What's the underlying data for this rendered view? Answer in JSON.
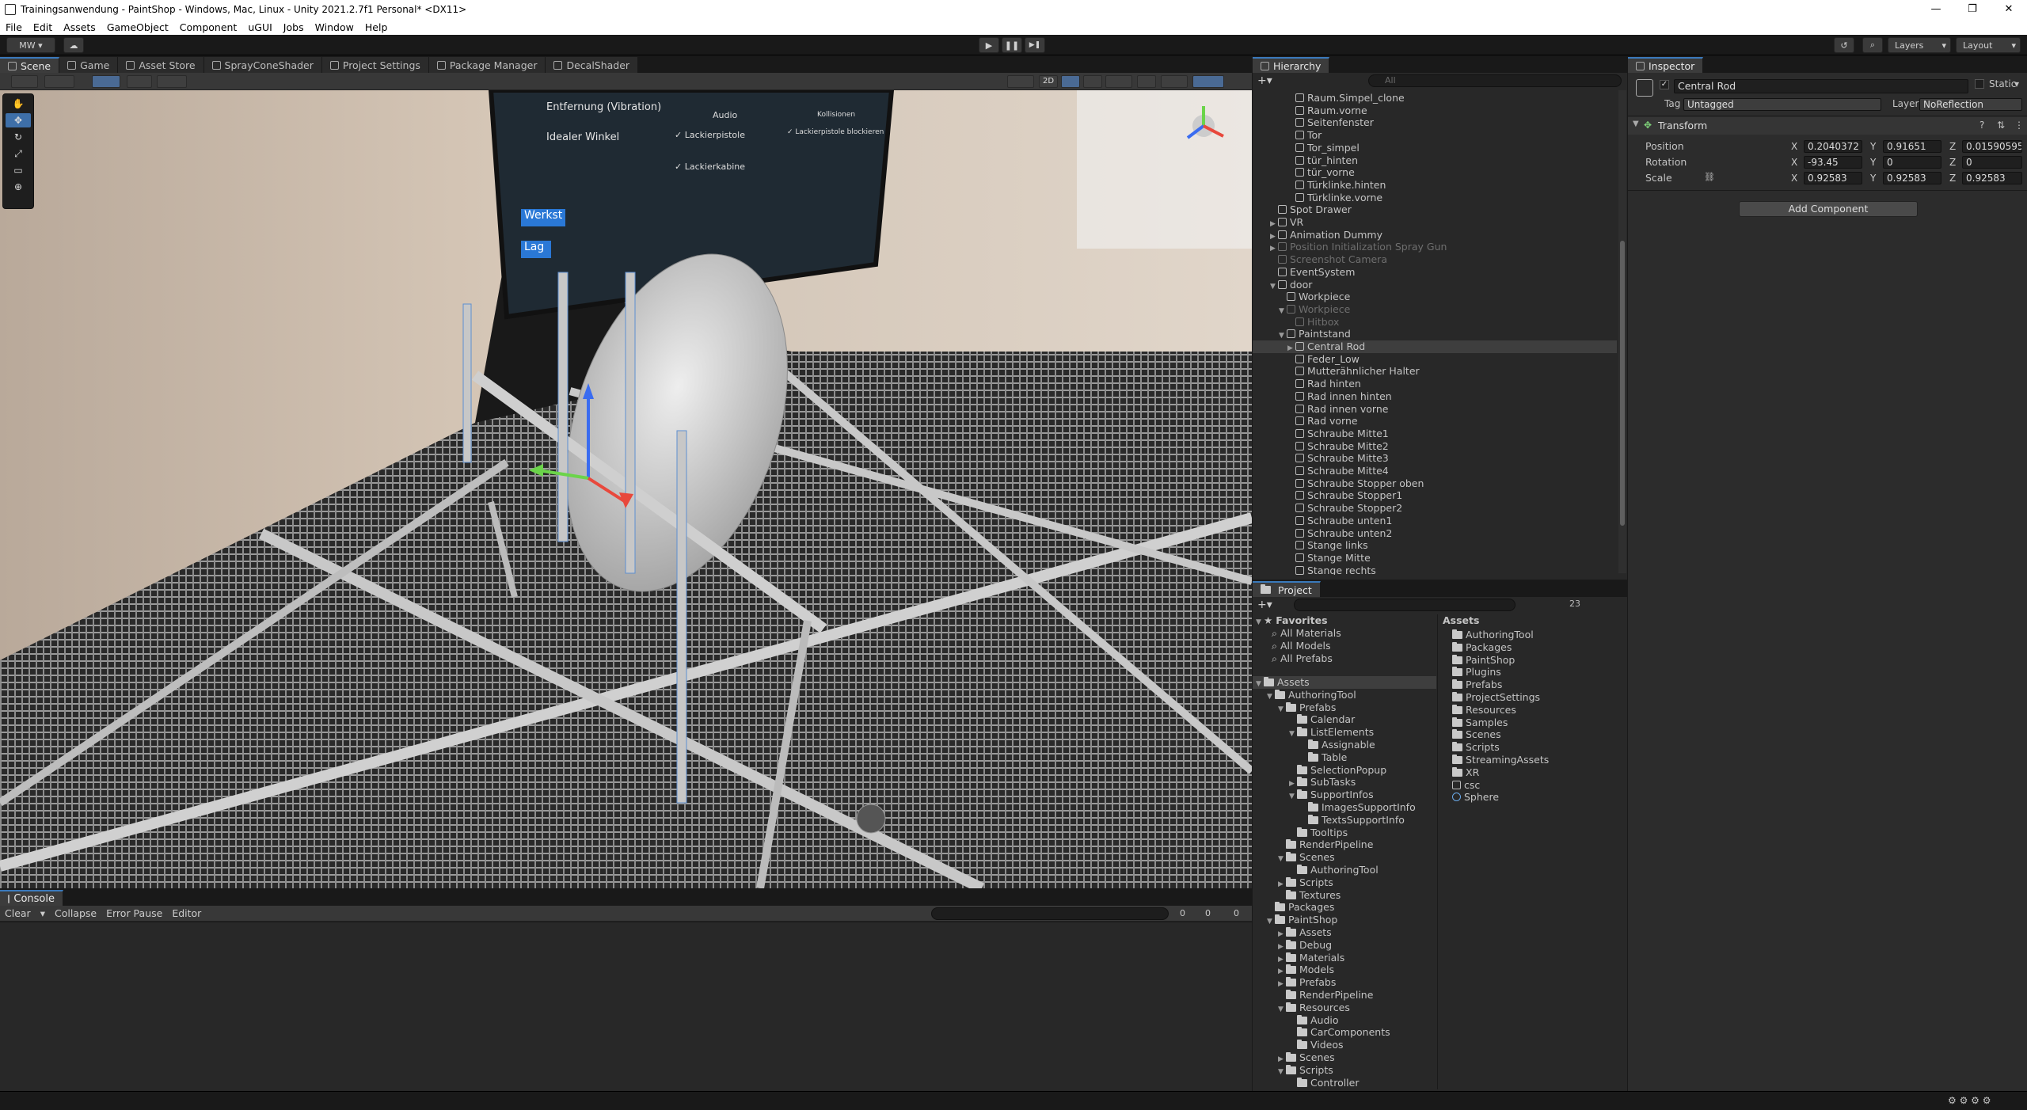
{
  "window": {
    "title": "Trainingsanwendung - PaintShop - Windows, Mac, Linux - Unity 2021.2.7f1 Personal* <DX11>",
    "controls": [
      "—",
      "❐",
      "✕"
    ]
  },
  "menu": [
    "File",
    "Edit",
    "Assets",
    "GameObject",
    "Component",
    "uGUI",
    "Jobs",
    "Window",
    "Help"
  ],
  "toolbar": {
    "account": "MW ▾",
    "play": "▶",
    "pause": "❚❚",
    "step": "▶❚",
    "layers": "Layers",
    "layout": "Layout"
  },
  "scene_tabs": [
    {
      "label": "Scene",
      "active": true
    },
    {
      "label": "Game",
      "active": false
    },
    {
      "label": "Asset Store",
      "active": false
    },
    {
      "label": "SprayConeShader",
      "active": false
    },
    {
      "label": "Project Settings",
      "active": false
    },
    {
      "label": "Package Manager",
      "active": false
    },
    {
      "label": "DecalShader",
      "active": false
    }
  ],
  "scene_toolbar": {
    "mode_2d": "2D"
  },
  "scene_view": {
    "board": {
      "item1": "Entfernung (Vibration)",
      "item2": "Idealer Winkel",
      "audio_heading": "Audio",
      "audio_check1": "Lackierpistole",
      "audio_check2": "Lackierkabine",
      "collision_heading": "Kollisionen",
      "collision_check": "Lackierpistole blockieren",
      "btn1": "Werkst",
      "btn2": "Lag"
    }
  },
  "console": {
    "tab": "Console",
    "clear": "Clear",
    "collapse": "Collapse",
    "error_pause": "Error Pause",
    "editor": "Editor",
    "count_info": "0",
    "count_warn": "0",
    "count_error": "0"
  },
  "hierarchy": {
    "tab": "Hierarchy",
    "search_placeholder": "All",
    "rows": [
      {
        "label": "Raum.Simpel_clone",
        "indent": 4,
        "dim": false,
        "arrow": ""
      },
      {
        "label": "Raum.vorne",
        "indent": 4,
        "dim": false,
        "arrow": ""
      },
      {
        "label": "Seitenfenster",
        "indent": 4,
        "dim": false,
        "arrow": ""
      },
      {
        "label": "Tor",
        "indent": 4,
        "dim": false,
        "arrow": ""
      },
      {
        "label": "Tor_simpel",
        "indent": 4,
        "dim": false,
        "arrow": ""
      },
      {
        "label": "tür_hinten",
        "indent": 4,
        "dim": false,
        "arrow": ""
      },
      {
        "label": "tür_vorne",
        "indent": 4,
        "dim": false,
        "arrow": ""
      },
      {
        "label": "Türklinke.hinten",
        "indent": 4,
        "dim": false,
        "arrow": ""
      },
      {
        "label": "Türklinke.vorne",
        "indent": 4,
        "dim": false,
        "arrow": ""
      },
      {
        "label": "Spot Drawer",
        "indent": 2,
        "dim": false,
        "arrow": ""
      },
      {
        "label": "VR",
        "indent": 2,
        "dim": false,
        "arrow": "▶"
      },
      {
        "label": "Animation Dummy",
        "indent": 2,
        "dim": false,
        "arrow": "▶"
      },
      {
        "label": "Position Initialization Spray Gun",
        "indent": 2,
        "dim": true,
        "arrow": "▶"
      },
      {
        "label": "Screenshot Camera",
        "indent": 2,
        "dim": true,
        "arrow": ""
      },
      {
        "label": "EventSystem",
        "indent": 2,
        "dim": false,
        "arrow": ""
      },
      {
        "label": "door",
        "indent": 2,
        "dim": false,
        "arrow": "▼"
      },
      {
        "label": "Workpiece",
        "indent": 3,
        "dim": false,
        "arrow": ""
      },
      {
        "label": "Workpiece",
        "indent": 3,
        "dim": true,
        "arrow": "▼"
      },
      {
        "label": "Hitbox",
        "indent": 4,
        "dim": true,
        "arrow": ""
      },
      {
        "label": "Paintstand",
        "indent": 3,
        "dim": false,
        "arrow": "▼"
      },
      {
        "label": "Central Rod",
        "indent": 4,
        "dim": false,
        "arrow": "▶",
        "selected": true
      },
      {
        "label": "Feder_Low",
        "indent": 4,
        "dim": false,
        "arrow": ""
      },
      {
        "label": "Mutterähnlicher Halter",
        "indent": 4,
        "dim": false,
        "arrow": ""
      },
      {
        "label": "Rad hinten",
        "indent": 4,
        "dim": false,
        "arrow": ""
      },
      {
        "label": "Rad innen hinten",
        "indent": 4,
        "dim": false,
        "arrow": ""
      },
      {
        "label": "Rad innen vorne",
        "indent": 4,
        "dim": false,
        "arrow": ""
      },
      {
        "label": "Rad vorne",
        "indent": 4,
        "dim": false,
        "arrow": ""
      },
      {
        "label": "Schraube Mitte1",
        "indent": 4,
        "dim": false,
        "arrow": ""
      },
      {
        "label": "Schraube Mitte2",
        "indent": 4,
        "dim": false,
        "arrow": ""
      },
      {
        "label": "Schraube Mitte3",
        "indent": 4,
        "dim": false,
        "arrow": ""
      },
      {
        "label": "Schraube Mitte4",
        "indent": 4,
        "dim": false,
        "arrow": ""
      },
      {
        "label": "Schraube Stopper oben",
        "indent": 4,
        "dim": false,
        "arrow": ""
      },
      {
        "label": "Schraube Stopper1",
        "indent": 4,
        "dim": false,
        "arrow": ""
      },
      {
        "label": "Schraube Stopper2",
        "indent": 4,
        "dim": false,
        "arrow": ""
      },
      {
        "label": "Schraube unten1",
        "indent": 4,
        "dim": false,
        "arrow": ""
      },
      {
        "label": "Schraube unten2",
        "indent": 4,
        "dim": false,
        "arrow": ""
      },
      {
        "label": "Stange links",
        "indent": 4,
        "dim": false,
        "arrow": ""
      },
      {
        "label": "Stange Mitte",
        "indent": 4,
        "dim": false,
        "arrow": ""
      },
      {
        "label": "Stange rechts",
        "indent": 4,
        "dim": false,
        "arrow": ""
      }
    ]
  },
  "inspector": {
    "tab": "Inspector",
    "object_name": "Central Rod",
    "static_label": "Static",
    "tag_label": "Tag",
    "tag_value": "Untagged",
    "layer_label": "Layer",
    "layer_value": "NoReflection",
    "component": "Transform",
    "position_label": "Position",
    "rotation_label": "Rotation",
    "scale_label": "Scale",
    "position": {
      "x": "0.2040372",
      "y": "0.91651",
      "z": "0.01590595"
    },
    "rotation": {
      "x": "-93.45",
      "y": "0",
      "z": "0"
    },
    "scale": {
      "x": "0.92583",
      "y": "0.92583",
      "z": "0.92583"
    },
    "add_component": "Add Component"
  },
  "project": {
    "tab": "Project",
    "hidden_count": "23",
    "favorites_label": "Favorites",
    "favorites": [
      "All Materials",
      "All Models",
      "All Prefabs"
    ],
    "tree": [
      {
        "label": "Assets",
        "indent": 0,
        "arrow": "▼",
        "selected": true
      },
      {
        "label": "AuthoringTool",
        "indent": 1,
        "arrow": "▼"
      },
      {
        "label": "Prefabs",
        "indent": 2,
        "arrow": "▼"
      },
      {
        "label": "Calendar",
        "indent": 3,
        "arrow": ""
      },
      {
        "label": "ListElements",
        "indent": 3,
        "arrow": "▼"
      },
      {
        "label": "Assignable",
        "indent": 4,
        "arrow": ""
      },
      {
        "label": "Table",
        "indent": 4,
        "arrow": ""
      },
      {
        "label": "SelectionPopup",
        "indent": 3,
        "arrow": ""
      },
      {
        "label": "SubTasks",
        "indent": 3,
        "arrow": "▶"
      },
      {
        "label": "SupportInfos",
        "indent": 3,
        "arrow": "▼"
      },
      {
        "label": "ImagesSupportInfo",
        "indent": 4,
        "arrow": ""
      },
      {
        "label": "TextsSupportInfo",
        "indent": 4,
        "arrow": ""
      },
      {
        "label": "Tooltips",
        "indent": 3,
        "arrow": ""
      },
      {
        "label": "RenderPipeline",
        "indent": 2,
        "arrow": ""
      },
      {
        "label": "Scenes",
        "indent": 2,
        "arrow": "▼"
      },
      {
        "label": "AuthoringTool",
        "indent": 3,
        "arrow": ""
      },
      {
        "label": "Scripts",
        "indent": 2,
        "arrow": "▶"
      },
      {
        "label": "Textures",
        "indent": 2,
        "arrow": ""
      },
      {
        "label": "Packages",
        "indent": 1,
        "arrow": ""
      },
      {
        "label": "PaintShop",
        "indent": 1,
        "arrow": "▼"
      },
      {
        "label": "Assets",
        "indent": 2,
        "arrow": "▶"
      },
      {
        "label": "Debug",
        "indent": 2,
        "arrow": "▶"
      },
      {
        "label": "Materials",
        "indent": 2,
        "arrow": "▶"
      },
      {
        "label": "Models",
        "indent": 2,
        "arrow": "▶"
      },
      {
        "label": "Prefabs",
        "indent": 2,
        "arrow": "▶"
      },
      {
        "label": "RenderPipeline",
        "indent": 2,
        "arrow": ""
      },
      {
        "label": "Resources",
        "indent": 2,
        "arrow": "▼"
      },
      {
        "label": "Audio",
        "indent": 3,
        "arrow": ""
      },
      {
        "label": "CarComponents",
        "indent": 3,
        "arrow": ""
      },
      {
        "label": "Videos",
        "indent": 3,
        "arrow": ""
      },
      {
        "label": "Scenes",
        "indent": 2,
        "arrow": "▶"
      },
      {
        "label": "Scripts",
        "indent": 2,
        "arrow": "▼"
      },
      {
        "label": "Controller",
        "indent": 3,
        "arrow": ""
      }
    ],
    "assets_heading": "Assets",
    "assets": [
      {
        "label": "AuthoringTool",
        "type": "folder"
      },
      {
        "label": "Packages",
        "type": "folder"
      },
      {
        "label": "PaintShop",
        "type": "folder"
      },
      {
        "label": "Plugins",
        "type": "folder"
      },
      {
        "label": "Prefabs",
        "type": "folder"
      },
      {
        "label": "ProjectSettings",
        "type": "folder"
      },
      {
        "label": "Resources",
        "type": "folder"
      },
      {
        "label": "Samples",
        "type": "folder"
      },
      {
        "label": "Scenes",
        "type": "folder"
      },
      {
        "label": "Scripts",
        "type": "folder"
      },
      {
        "label": "StreamingAssets",
        "type": "folder"
      },
      {
        "label": "XR",
        "type": "folder"
      },
      {
        "label": "csc",
        "type": "file"
      },
      {
        "label": "Sphere",
        "type": "prefab"
      }
    ]
  }
}
